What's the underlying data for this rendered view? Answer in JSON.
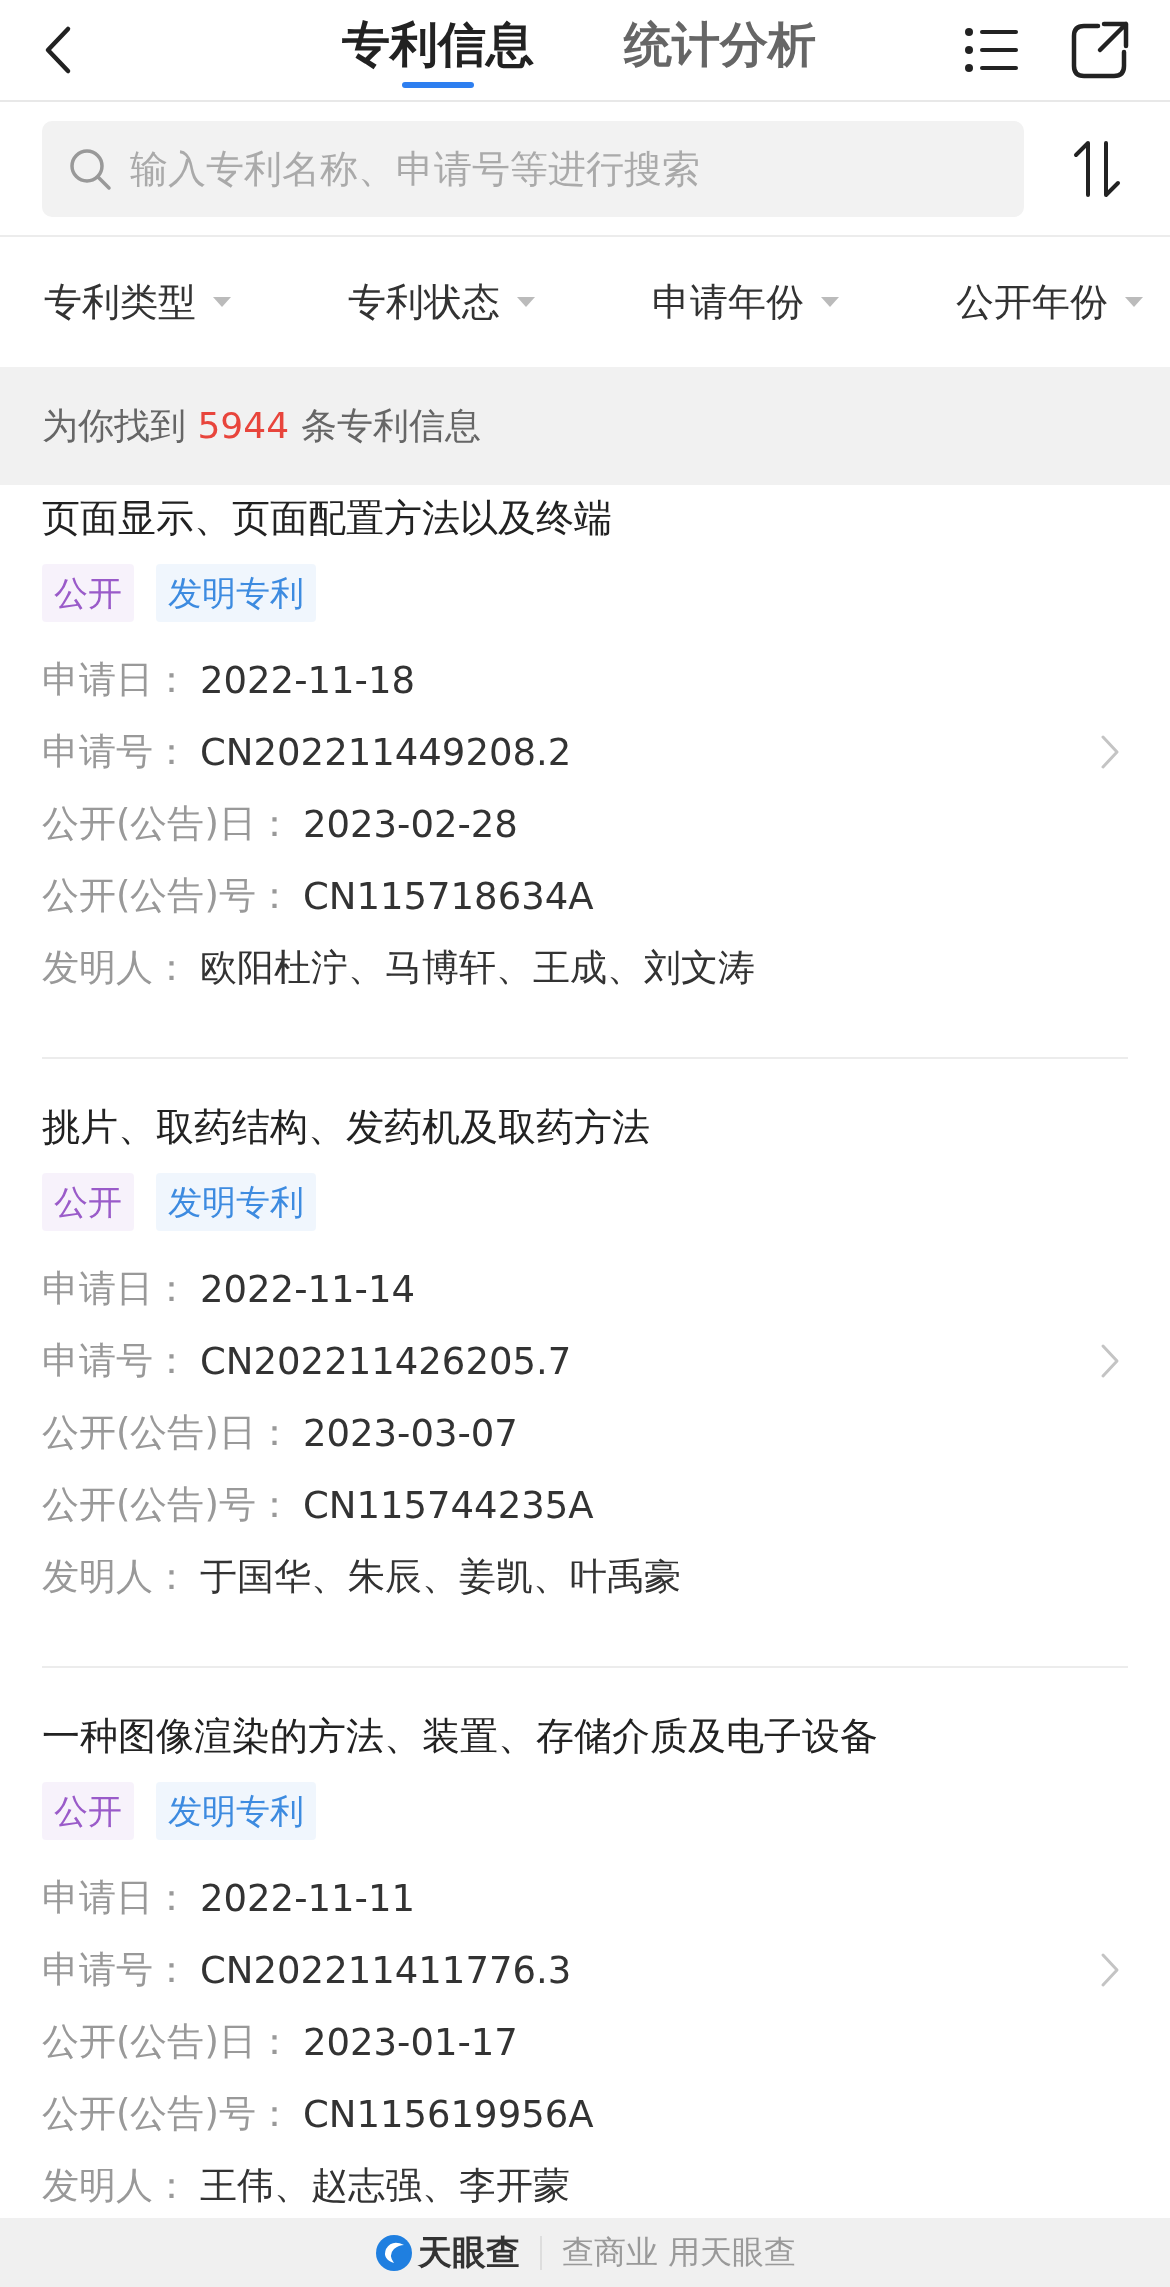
{
  "tabs": [
    {
      "label": "专利信息",
      "selected": true
    },
    {
      "label": "统计分析",
      "selected": false
    }
  ],
  "search": {
    "placeholder": "输入专利名称、申请号等进行搜索"
  },
  "filters": [
    "专利类型",
    "专利状态",
    "申请年份",
    "公开年份"
  ],
  "result_count": {
    "prefix": "为你找到",
    "count": "5944",
    "suffix": "条专利信息"
  },
  "patents": [
    {
      "title": "页面显示、页面配置方法以及终端",
      "tags": [
        {
          "label": "公开",
          "color": "#9a5bc9"
        },
        {
          "label": "发明专利",
          "color": "#3d8be0"
        }
      ],
      "fields": [
        {
          "label": "申请日：",
          "value": "2022-11-18"
        },
        {
          "label": "申请号：",
          "value": "CN202211449208.2"
        },
        {
          "label": "公开(公告)日：",
          "value": "2023-02-28"
        },
        {
          "label": "公开(公告)号：",
          "value": "CN115718634A"
        },
        {
          "label": "发明人：",
          "value": "欧阳杜泞、马博轩、王成、刘文涛"
        }
      ]
    },
    {
      "title": "挑片、取药结构、发药机及取药方法",
      "tags": [
        {
          "label": "公开",
          "color": "#9a5bc9"
        },
        {
          "label": "发明专利",
          "color": "#3d8be0"
        }
      ],
      "fields": [
        {
          "label": "申请日：",
          "value": "2022-11-14"
        },
        {
          "label": "申请号：",
          "value": "CN202211426205.7"
        },
        {
          "label": "公开(公告)日：",
          "value": "2023-03-07"
        },
        {
          "label": "公开(公告)号：",
          "value": "CN115744235A"
        },
        {
          "label": "发明人：",
          "value": "于国华、朱辰、姜凯、叶禹豪"
        }
      ]
    },
    {
      "title": "一种图像渲染的方法、装置、存储介质及电子设备",
      "tags": [
        {
          "label": "公开",
          "color": "#9a5bc9"
        },
        {
          "label": "发明专利",
          "color": "#3d8be0"
        }
      ],
      "fields": [
        {
          "label": "申请日：",
          "value": "2022-11-11"
        },
        {
          "label": "申请号：",
          "value": "CN202211411776.3"
        },
        {
          "label": "公开(公告)日：",
          "value": "2023-01-17"
        },
        {
          "label": "公开(公告)号：",
          "value": "CN115619956A"
        },
        {
          "label": "发明人：",
          "value": "王伟、赵志强、李开蒙"
        }
      ]
    }
  ],
  "footer": {
    "brand": "天眼查",
    "slogan": "查商业 用天眼查"
  }
}
